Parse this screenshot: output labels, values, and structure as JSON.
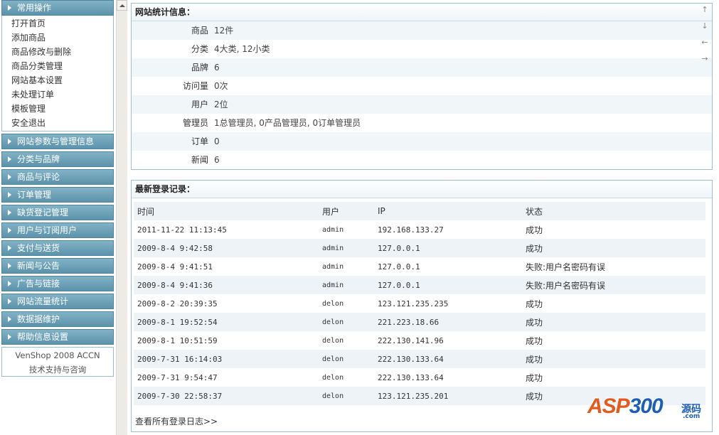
{
  "menu": {
    "open_section": {
      "label": "常用操作",
      "items": [
        "打开首页",
        "添加商品",
        "商品修改与删除",
        "商品分类管理",
        "网站基本设置",
        "未处理订单",
        "模板管理",
        "安全退出"
      ]
    },
    "sections": [
      "网站参数与管理信息",
      "分类与品牌",
      "商品与评论",
      "订单管理",
      "缺货登记管理",
      "用户与订阅用户",
      "支付与送货",
      "新闻与公告",
      "广告与链接",
      "网站流量统计",
      "数据据维护",
      "帮助信息设置"
    ],
    "footer": [
      "VenShop 2008 ACCN",
      "技术支持与咨询"
    ]
  },
  "stats": {
    "title": "网站统计信息：",
    "rows": [
      {
        "label": "商品",
        "value": "12件"
      },
      {
        "label": "分类",
        "value": "4大类, 12小类"
      },
      {
        "label": "品牌",
        "value": "6"
      },
      {
        "label": "访问量",
        "value": "0次"
      },
      {
        "label": "用户",
        "value": "2位"
      },
      {
        "label": "管理员",
        "value": "1总管理员, 0产品管理员, 0订单管理员"
      },
      {
        "label": "订单",
        "value": "0"
      },
      {
        "label": "新闻",
        "value": "6"
      }
    ],
    "nav_arrows": [
      "↑",
      "↓",
      "←",
      "→"
    ]
  },
  "login_log": {
    "title": "最新登录记录：",
    "columns": [
      "时间",
      "用户",
      "IP",
      "状态"
    ],
    "rows": [
      [
        "2011-11-22 11:13:45",
        "admin",
        "192.168.133.27",
        "成功"
      ],
      [
        "2009-8-4 9:42:58",
        "admin",
        "127.0.0.1",
        "成功"
      ],
      [
        "2009-8-4 9:41:51",
        "admin",
        "127.0.0.1",
        "失败:用户名密码有误"
      ],
      [
        "2009-8-4 9:41:36",
        "admin",
        "127.0.0.1",
        "失败:用户名密码有误"
      ],
      [
        "2009-8-2 20:39:35",
        "delon",
        "123.121.235.235",
        "成功"
      ],
      [
        "2009-8-1 19:52:54",
        "delon",
        "221.223.18.66",
        "成功"
      ],
      [
        "2009-8-1 10:51:59",
        "delon",
        "222.130.141.96",
        "成功"
      ],
      [
        "2009-7-31 16:14:03",
        "delon",
        "222.130.133.64",
        "成功"
      ],
      [
        "2009-7-31 9:54:47",
        "delon",
        "222.130.133.64",
        "成功"
      ],
      [
        "2009-7-30 22:58:37",
        "delon",
        "123.121.235.201",
        "成功"
      ]
    ],
    "view_all": "查看所有登录日志>>"
  },
  "watermark": {
    "text_orange": "ASP",
    "text_blue": "300",
    "cn": "源码",
    "domain": ".com"
  }
}
